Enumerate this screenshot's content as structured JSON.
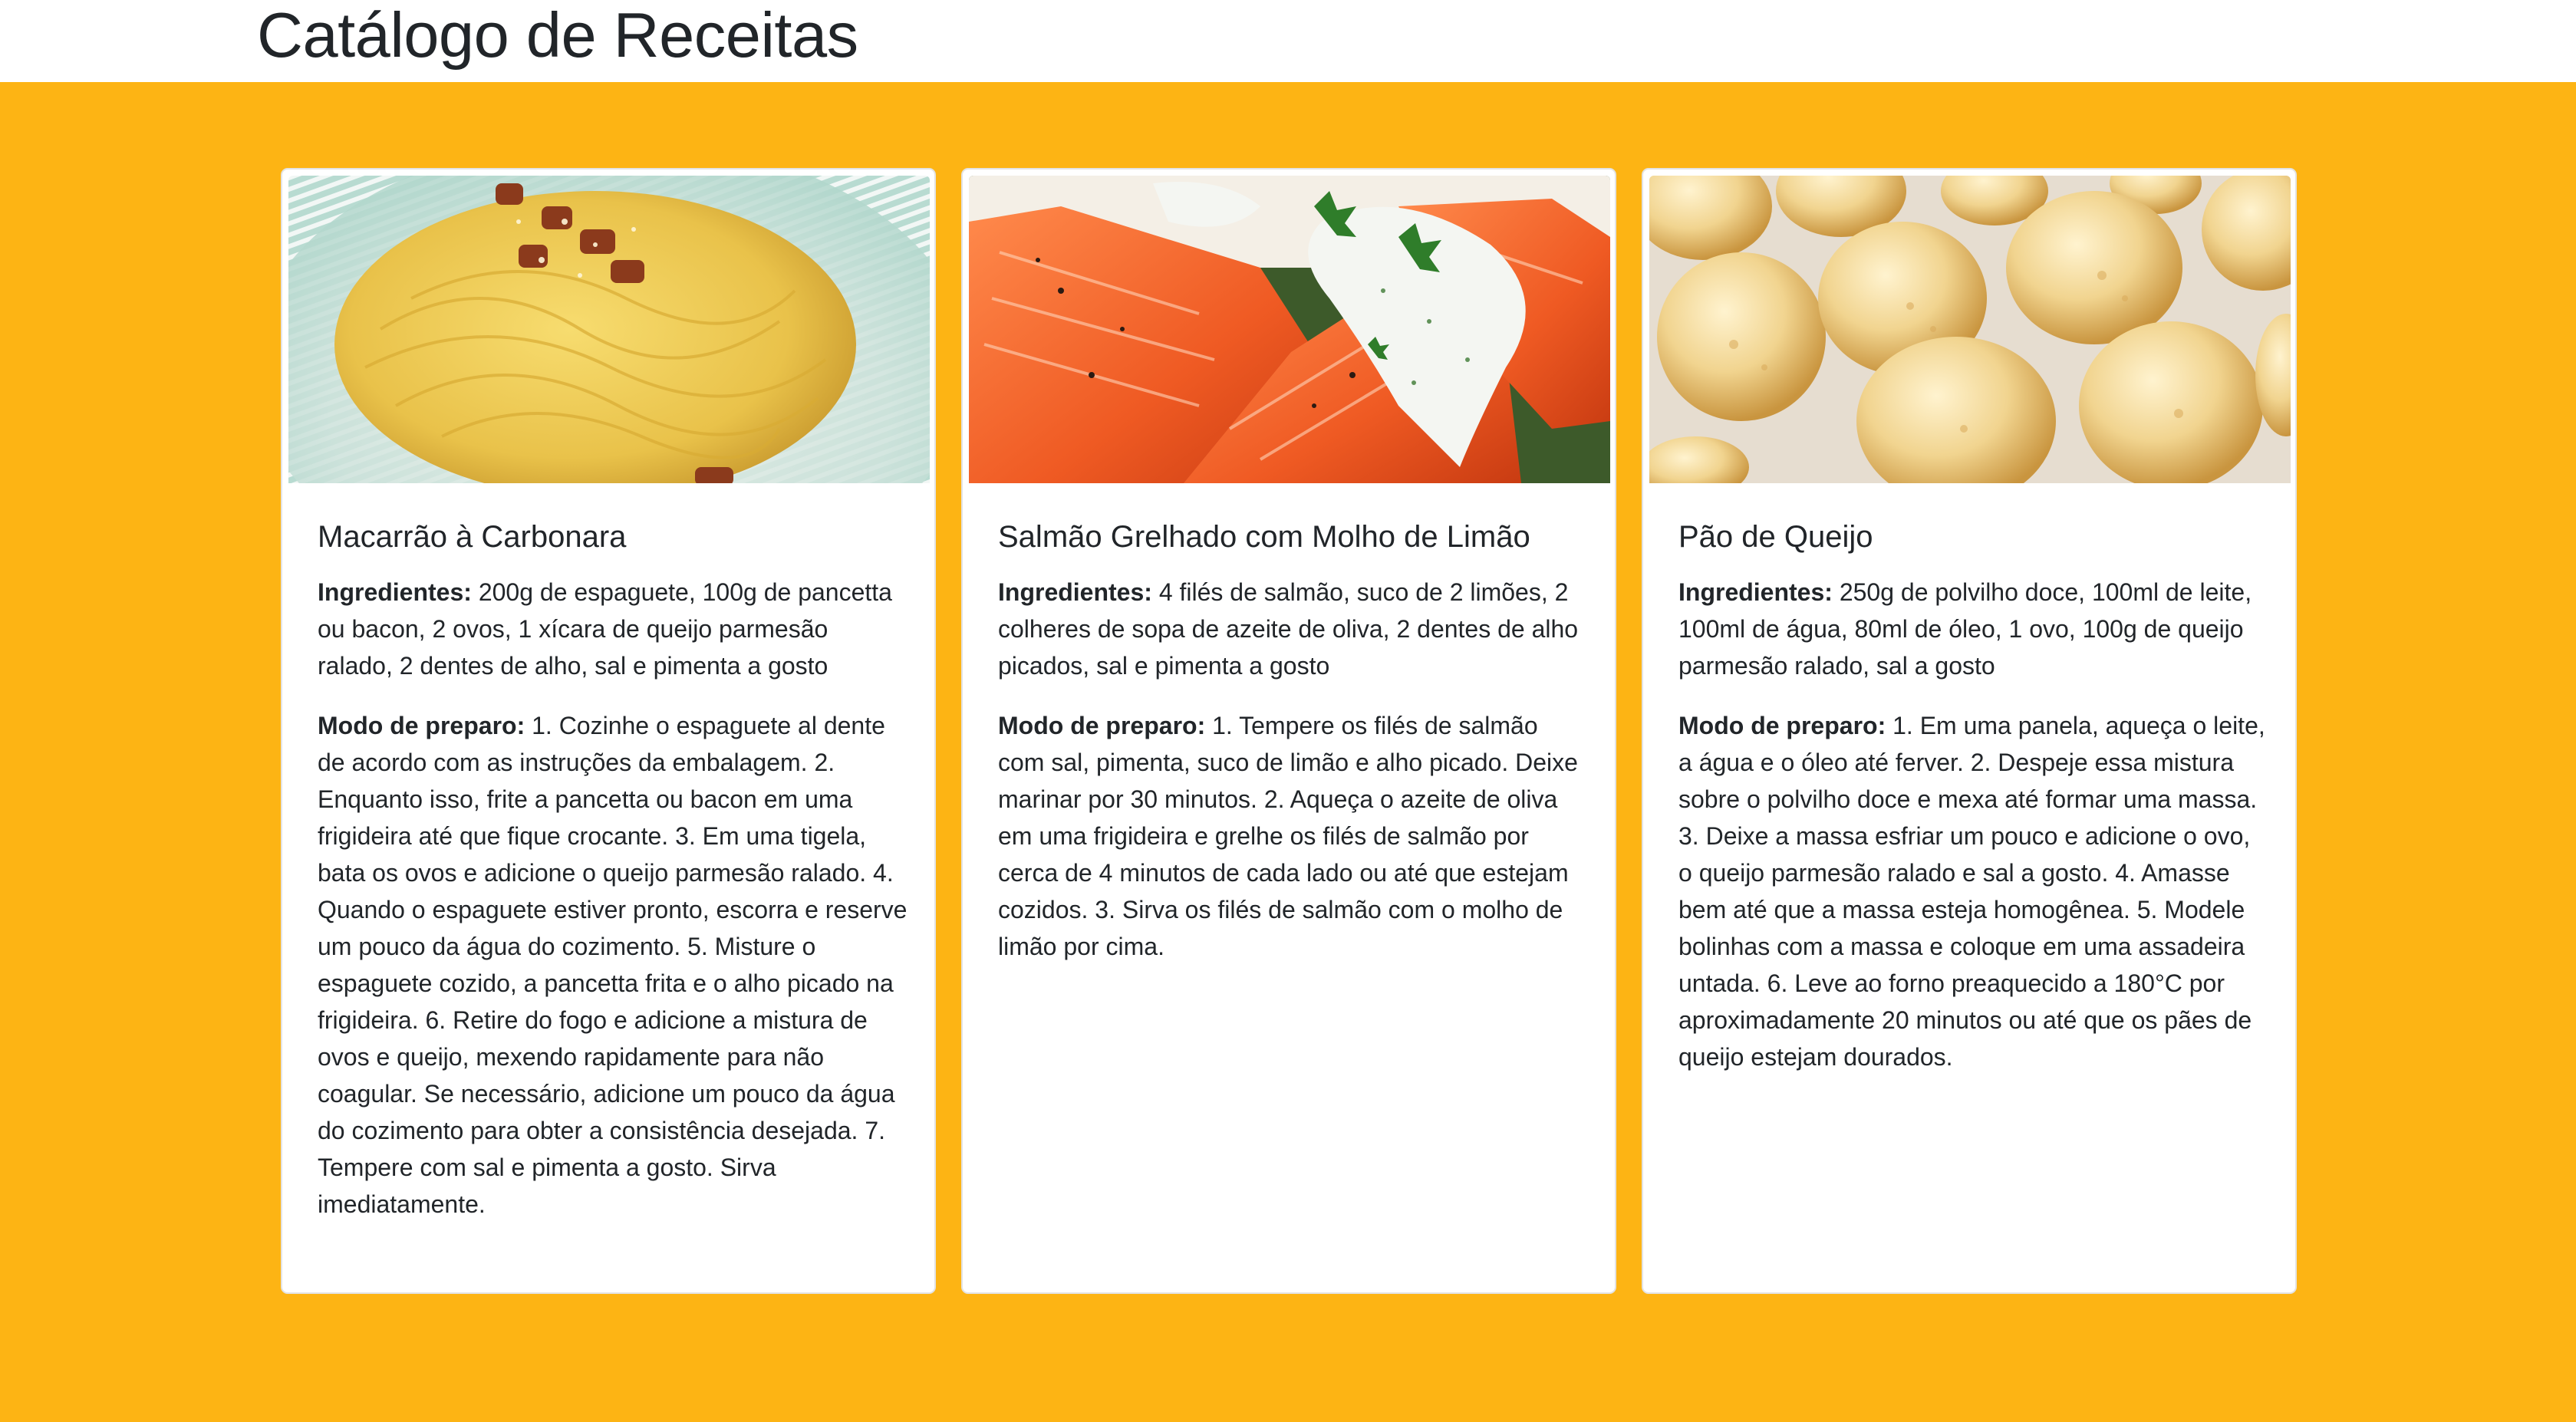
{
  "page": {
    "title": "Catálogo de Receitas"
  },
  "colors": {
    "background": "#fdb414",
    "card": "#ffffff",
    "text": "#212529"
  },
  "labels": {
    "ingredients": "Ingredientes:",
    "preparation": "Modo de preparo:"
  },
  "recipes": [
    {
      "name": "Macarrão à Carbonara",
      "image": "carbonara-photo",
      "ingredients": "200g de espaguete, 100g de pancetta ou bacon, 2 ovos, 1 xícara de queijo parmesão ralado, 2 dentes de alho, sal e pimenta a gosto",
      "preparation": "1. Cozinhe o espaguete al dente de acordo com as instruções da embalagem. 2. Enquanto isso, frite a pancetta ou bacon em uma frigideira até que fique crocante. 3. Em uma tigela, bata os ovos e adicione o queijo parmesão ralado. 4. Quando o espaguete estiver pronto, escorra e reserve um pouco da água do cozimento. 5. Misture o espaguete cozido, a pancetta frita e o alho picado na frigideira. 6. Retire do fogo e adicione a mistura de ovos e queijo, mexendo rapidamente para não coagular. Se necessário, adicione um pouco da água do cozimento para obter a consistência desejada. 7. Tempere com sal e pimenta a gosto. Sirva imediatamente."
    },
    {
      "name": "Salmão Grelhado com Molho de Limão",
      "image": "salmon-photo",
      "ingredients": "4 filés de salmão, suco de 2 limões, 2 colheres de sopa de azeite de oliva, 2 dentes de alho picados, sal e pimenta a gosto",
      "preparation": "1. Tempere os filés de salmão com sal, pimenta, suco de limão e alho picado. Deixe marinar por 30 minutos. 2. Aqueça o azeite de oliva em uma frigideira e grelhe os filés de salmão por cerca de 4 minutos de cada lado ou até que estejam cozidos. 3. Sirva os filés de salmão com o molho de limão por cima."
    },
    {
      "name": "Pão de Queijo",
      "image": "cheese-bread-photo",
      "ingredients": "250g de polvilho doce, 100ml de leite, 100ml de água, 80ml de óleo, 1 ovo, 100g de queijo parmesão ralado, sal a gosto",
      "preparation": "1. Em uma panela, aqueça o leite, a água e o óleo até ferver. 2. Despeje essa mistura sobre o polvilho doce e mexa até formar uma massa. 3. Deixe a massa esfriar um pouco e adicione o ovo, o queijo parmesão ralado e sal a gosto. 4. Amasse bem até que a massa esteja homogênea. 5. Modele bolinhas com a massa e coloque em uma assadeira untada. 6. Leve ao forno preaquecido a 180°C por aproximadamente 20 minutos ou até que os pães de queijo estejam dourados."
    }
  ]
}
